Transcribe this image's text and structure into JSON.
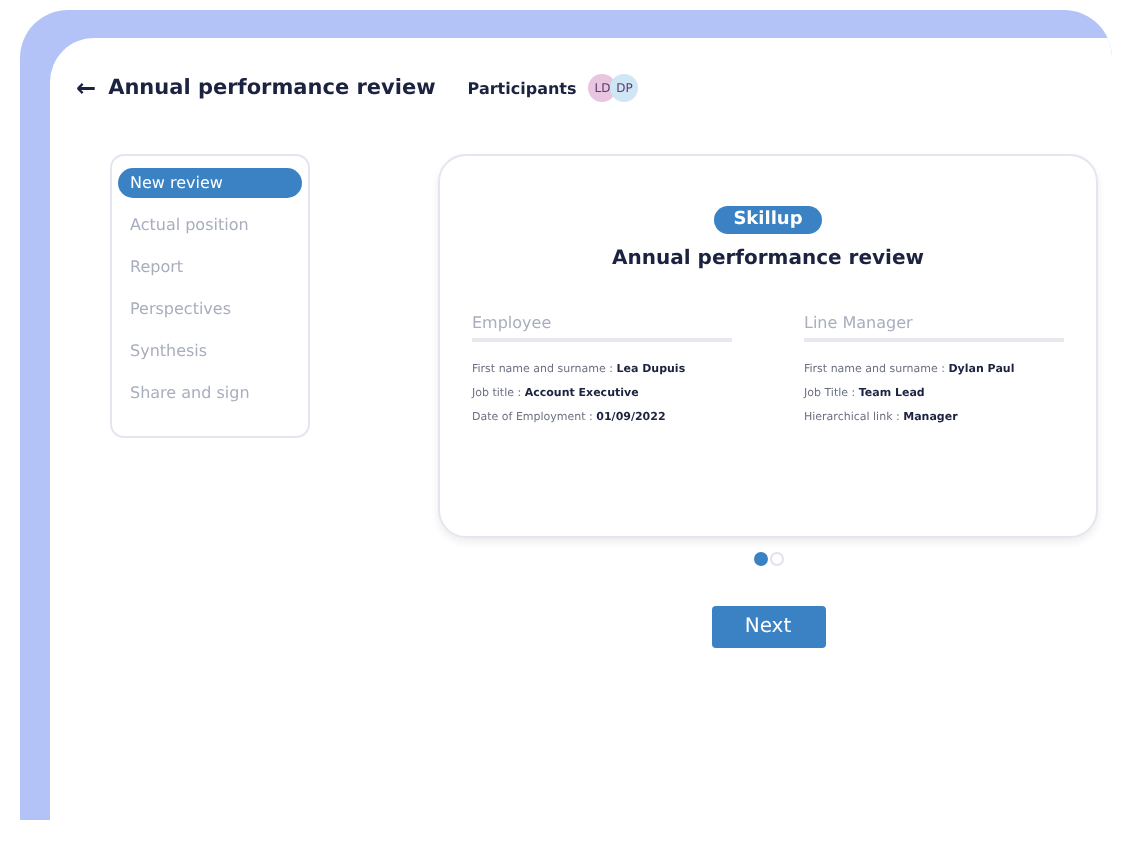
{
  "header": {
    "back_icon": "←",
    "title": "Annual performance review",
    "participants_label": "Participants",
    "participants": [
      {
        "initials": "LD",
        "color": "#e8c6e0"
      },
      {
        "initials": "DP",
        "color": "#cfe6f5"
      }
    ]
  },
  "steps": [
    {
      "label": "New review",
      "selected": true
    },
    {
      "label": "Actual position",
      "selected": false
    },
    {
      "label": "Report",
      "selected": false
    },
    {
      "label": "Perspectives",
      "selected": false
    },
    {
      "label": "Synthesis",
      "selected": false
    },
    {
      "label": "Share and sign",
      "selected": false
    }
  ],
  "card": {
    "logo": "Skillup",
    "title": "Annual performance review",
    "sections": [
      {
        "heading": "Employee",
        "lines": [
          "First name and surname : **Lea Dupuis**",
          "Job title : **Account Executive**",
          "Date of Employment : **01/09/2022**"
        ]
      },
      {
        "heading": "Line Manager",
        "lines": [
          "First name and surname : **Dylan Paul**",
          "Job Title : **Team Lead**",
          "Hierarchical link : **Manager**"
        ]
      }
    ]
  },
  "pages": [
    {
      "selected": true
    },
    {
      "selected": false
    }
  ],
  "next_button": "Next"
}
